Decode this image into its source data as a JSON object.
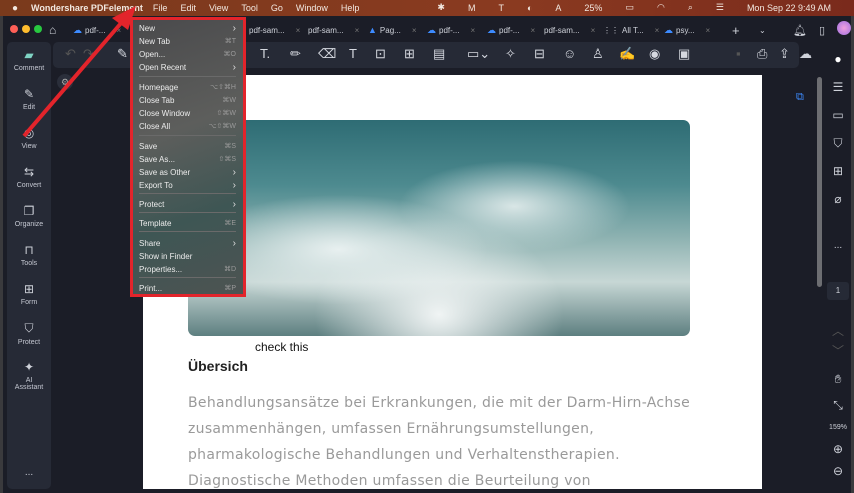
{
  "menubar": {
    "app": "Wondershare PDFelement",
    "items": [
      "File",
      "Edit",
      "View",
      "Tool",
      "Go",
      "Window",
      "Help"
    ],
    "battery": "25%",
    "datetime": "Mon Sep 22  9:49 AM"
  },
  "tabs": [
    "pdf-...",
    "pdf-sam...",
    "pdf-sam...",
    "Pag...",
    "pdf-...",
    "pdf-...",
    "pdf-sam...",
    "All T...",
    "psy..."
  ],
  "sidebar": [
    "Comment",
    "Edit",
    "View",
    "Convert",
    "Organize",
    "Tools",
    "Form",
    "Protect",
    "AI Assistant"
  ],
  "sidebar_more": "...",
  "rightbar": {
    "page": "1",
    "zoom": "159%",
    "more": "..."
  },
  "file_menu": [
    {
      "label": "New",
      "sc": "›"
    },
    {
      "label": "New Tab",
      "sc": "⌘T"
    },
    {
      "label": "Open...",
      "sc": "⌘O"
    },
    {
      "label": "Open Recent",
      "sc": "›"
    },
    {
      "label": "Homepage",
      "sc": "⌥⇧⌘H"
    },
    {
      "label": "Close Tab",
      "sc": "⌘W"
    },
    {
      "label": "Close Window",
      "sc": "⇧⌘W"
    },
    {
      "label": "Close All",
      "sc": "⌥⇧⌘W"
    },
    {
      "label": "Save",
      "sc": "⌘S"
    },
    {
      "label": "Save As...",
      "sc": "⇧⌘S"
    },
    {
      "label": "Save as Other",
      "sc": "›"
    },
    {
      "label": "Export To",
      "sc": "›"
    },
    {
      "label": "Protect",
      "sc": "›"
    },
    {
      "label": "Template",
      "sc": "⌘E"
    },
    {
      "label": "Share",
      "sc": "›"
    },
    {
      "label": "Show in Finder",
      "sc": ""
    },
    {
      "label": "Properties...",
      "sc": "⌘D"
    },
    {
      "label": "Print...",
      "sc": "⌘P"
    }
  ],
  "doc": {
    "annotation": "check this",
    "heading": "Übersich",
    "lines": [
      "Behandlungsansätze bei Erkrankungen, die mit der Darm-Hirn-Achse",
      "zusammenhängen, umfassen Ernährungsumstellungen,",
      "pharmakologische Behandlungen und Verhaltenstherapien.",
      "Diagnostische Methoden umfassen die Beurteilung von"
    ]
  },
  "colors": {
    "highlight": "#e3242b"
  }
}
